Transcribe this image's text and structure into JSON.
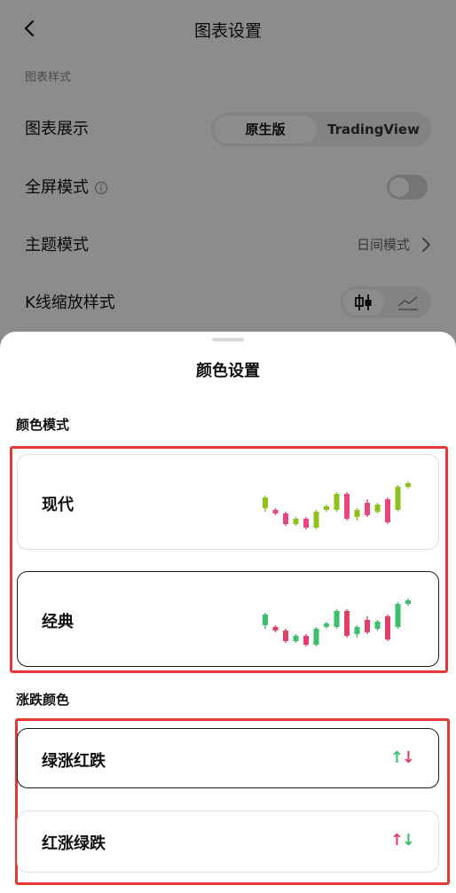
{
  "header": {
    "title": "图表设置"
  },
  "settings": {
    "section_label": "图表样式",
    "chart_display": {
      "label": "图表展示",
      "options": [
        "原生版",
        "TradingView"
      ],
      "selected": "原生版"
    },
    "fullscreen": {
      "label": "全屏模式",
      "enabled": false
    },
    "theme": {
      "label": "主题模式",
      "value": "日间模式"
    },
    "kline_zoom": {
      "label": "K线缩放样式",
      "options": [
        "candlestick-icon",
        "line-chart-icon"
      ],
      "selected": "candlestick-icon"
    }
  },
  "sheet": {
    "title": "颜色设置",
    "color_mode": {
      "title": "颜色模式",
      "options": [
        {
          "label": "现代",
          "selected": false,
          "up_color": "#8cc21a",
          "down_color": "#e8447f"
        },
        {
          "label": "经典",
          "selected": true,
          "up_color": "#3cc06b",
          "down_color": "#e0406a"
        }
      ]
    },
    "rise_fall": {
      "title": "涨跌颜色",
      "options": [
        {
          "label": "绿涨红跌",
          "selected": true,
          "up_arrow": "↑",
          "down_arrow": "↓",
          "up_color": "#3cc06b",
          "down_color": "#e0406a"
        },
        {
          "label": "红涨绿跌",
          "selected": false,
          "up_arrow": "↑",
          "down_arrow": "↓",
          "up_color": "#e0406a",
          "down_color": "#3cc06b"
        }
      ]
    }
  },
  "colors": {
    "highlight": "#e53935",
    "overlay": "rgba(0,0,0,0.45)"
  }
}
